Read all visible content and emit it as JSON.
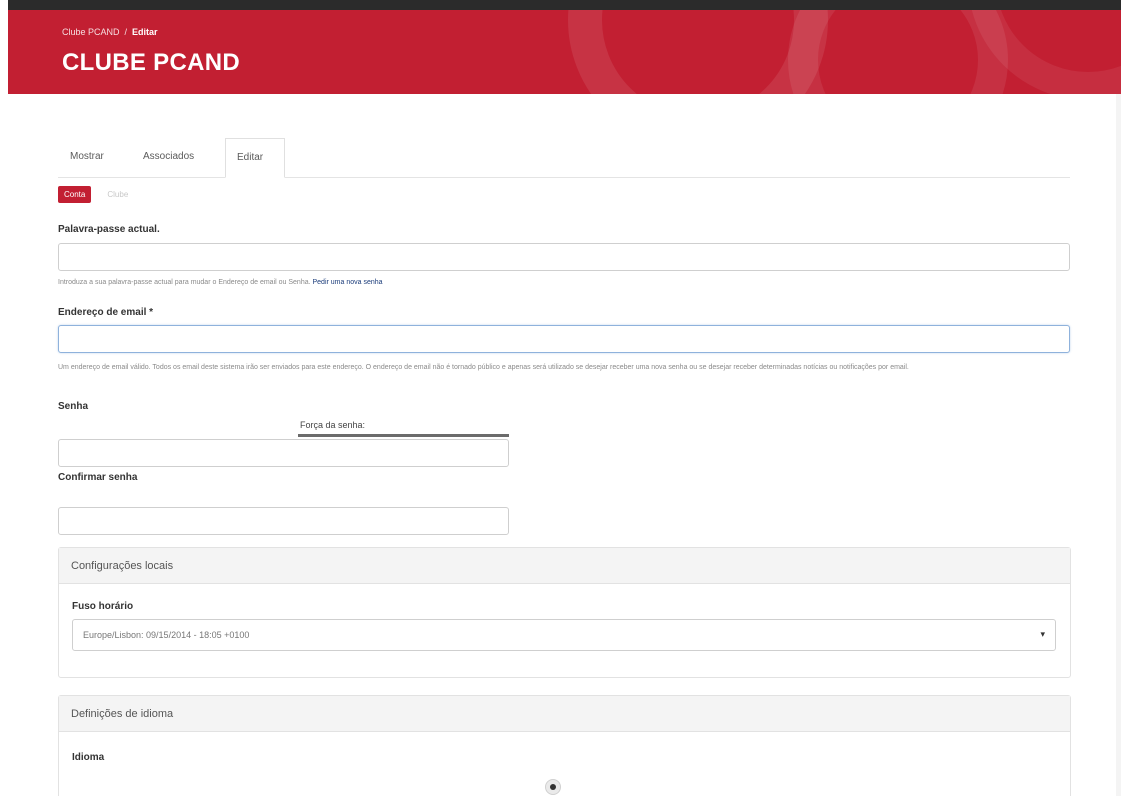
{
  "header": {
    "breadcrumb": [
      "Clube PCAND",
      "/",
      "Editar"
    ],
    "site_title": "CLUBE PCAND",
    "brand_color": "#c21f32"
  },
  "tabs": [
    {
      "label": "Mostrar",
      "active": false
    },
    {
      "label": "Associados",
      "active": false
    },
    {
      "label": "Editar",
      "active": true
    }
  ],
  "subtabs": [
    {
      "label": "Conta",
      "active": true
    },
    {
      "label": "Clube",
      "active": false
    }
  ],
  "form": {
    "current_password": {
      "label": "Palavra-passe actual.",
      "value": "",
      "help": "Introduza a sua palavra-passe actual para mudar o Endereço de email ou Senha.",
      "help_link": "Pedir uma nova senha"
    },
    "email": {
      "label": "Endereço de email *",
      "value": "",
      "help": "Um endereço de email válido. Todos os email deste sistema irão ser enviados para este endereço. O endereço de email não é tornado público e apenas será utilizado se desejar receber uma nova senha ou se desejar receber determinadas notícias ou notificações por email."
    },
    "password": {
      "label": "Senha",
      "value": "",
      "strength_label": "Força da senha:"
    },
    "confirm_password": {
      "label": "Confirmar senha",
      "value": ""
    }
  },
  "locale_panel": {
    "title": "Configurações locais",
    "timezone_label": "Fuso horário",
    "timezone_value": "Europe/Lisbon: 09/15/2014 - 18:05 +0100"
  },
  "language_panel": {
    "title": "Definições de idioma",
    "language_label": "Idioma"
  }
}
